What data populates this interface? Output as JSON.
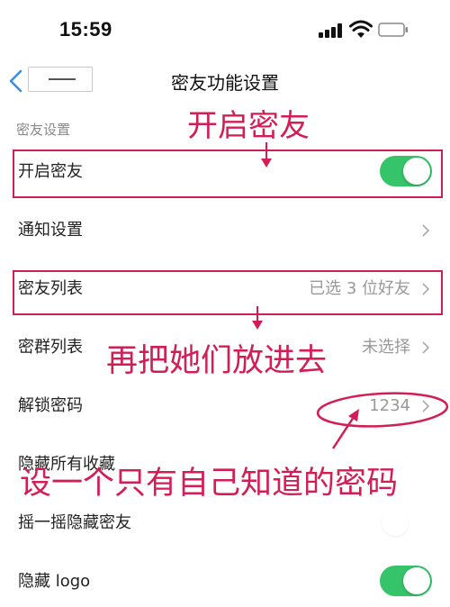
{
  "status_bar": {
    "time": "15:59",
    "icons": [
      "signal-icon",
      "wifi-icon",
      "battery-icon"
    ]
  },
  "nav": {
    "title": "密友功能设置",
    "back_icon": "chevron-left-icon"
  },
  "section": {
    "title": "密友设置"
  },
  "rows": [
    {
      "label": "开启密友",
      "control": "toggle",
      "on": true
    },
    {
      "label": "通知设置",
      "control": "chevron"
    },
    {
      "label": "密友列表",
      "value": "已选 3 位好友",
      "control": "chevron"
    },
    {
      "label": "密群列表",
      "value": "未选择",
      "control": "chevron"
    },
    {
      "label": "解锁密码",
      "value": "1234",
      "control": "chevron"
    },
    {
      "label": "隐藏所有收藏",
      "control": "none"
    },
    {
      "label": "摇一摇隐藏密友",
      "control": "toggle",
      "on": false
    },
    {
      "label": "隐藏 logo",
      "control": "toggle",
      "on": true
    }
  ],
  "annotations": {
    "enable_note": "开启密友",
    "list_note": "再把她们放进去",
    "password_note": "设一个只有自己知道的密码"
  },
  "colors": {
    "accent_toggle": "#35c46a",
    "back_chevron": "#3a8ee6",
    "annotation": "#d21e55",
    "secondary_text": "#999999"
  }
}
